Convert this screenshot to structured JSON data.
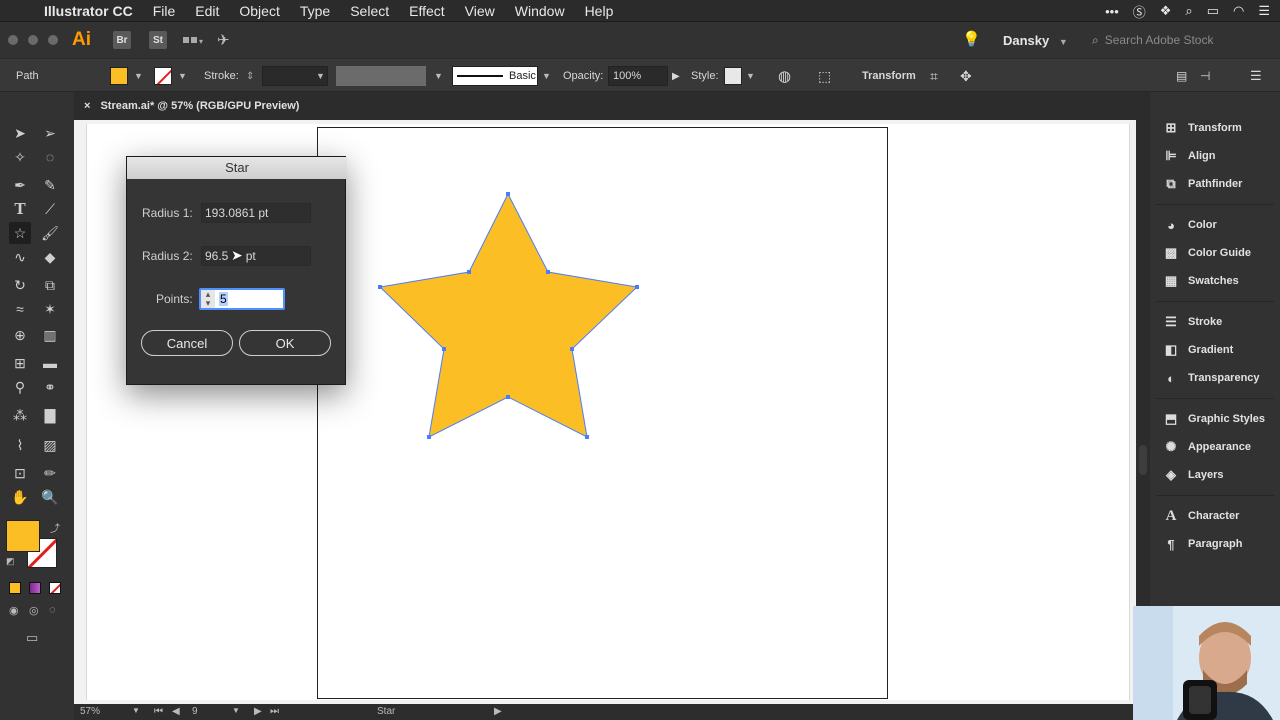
{
  "menubar": {
    "app_name": "Illustrator CC",
    "items": [
      "File",
      "Edit",
      "Object",
      "Type",
      "Select",
      "Effect",
      "View",
      "Window",
      "Help"
    ]
  },
  "appbar": {
    "logo": "Ai",
    "bridge_label": "Br",
    "stock_label": "St",
    "workspace": "Dansky",
    "search_placeholder": "Search Adobe Stock"
  },
  "control": {
    "selection_type": "Path",
    "stroke_label": "Stroke:",
    "brush_label": "Basic",
    "opacity_label": "Opacity:",
    "opacity_value": "100%",
    "style_label": "Style:",
    "transform_label": "Transform"
  },
  "document_tab": {
    "title": "Stream.ai* @ 57% (RGB/GPU Preview)",
    "close": "×"
  },
  "dialog": {
    "title": "Star",
    "radius1_label": "Radius 1:",
    "radius1_value": "193.0861 pt",
    "radius2_label": "Radius 2:",
    "radius2_value": "96.5",
    "radius2_unit": "pt",
    "points_label": "Points:",
    "points_value": "5",
    "cancel_label": "Cancel",
    "ok_label": "OK"
  },
  "status": {
    "zoom": "57%",
    "artboard_num": "9",
    "tool_name": "Star"
  },
  "panels": [
    {
      "label": "Transform",
      "icon": "transform-icon"
    },
    {
      "label": "Align",
      "icon": "align-icon"
    },
    {
      "label": "Pathfinder",
      "icon": "pathfinder-icon"
    },
    {
      "label": "Color",
      "icon": "color-icon"
    },
    {
      "label": "Color Guide",
      "icon": "color-guide-icon"
    },
    {
      "label": "Swatches",
      "icon": "swatches-icon"
    },
    {
      "label": "Stroke",
      "icon": "stroke-icon"
    },
    {
      "label": "Gradient",
      "icon": "gradient-icon"
    },
    {
      "label": "Transparency",
      "icon": "transparency-icon"
    },
    {
      "label": "Graphic Styles",
      "icon": "graphic-styles-icon"
    },
    {
      "label": "Appearance",
      "icon": "appearance-icon"
    },
    {
      "label": "Layers",
      "icon": "layers-icon"
    },
    {
      "label": "Character",
      "icon": "character-icon"
    },
    {
      "label": "Paragraph",
      "icon": "paragraph-icon"
    }
  ],
  "colors": {
    "star_fill": "#fbbf25",
    "selection": "#4a7cff",
    "accent": "#ff9a00"
  }
}
